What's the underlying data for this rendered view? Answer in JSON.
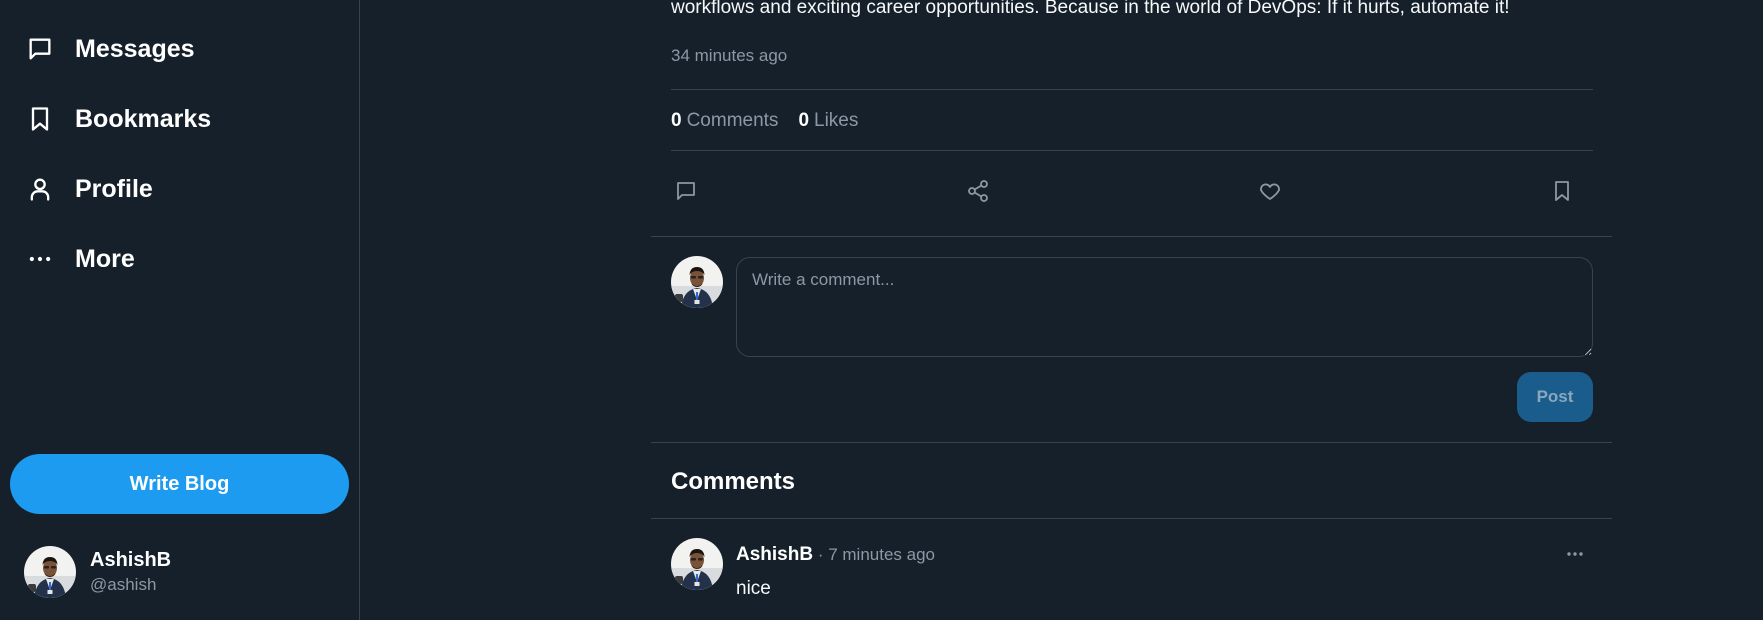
{
  "sidebar": {
    "nav": [
      {
        "label": "Messages",
        "icon": "message-icon"
      },
      {
        "label": "Bookmarks",
        "icon": "bookmark-icon"
      },
      {
        "label": "Profile",
        "icon": "user-icon"
      },
      {
        "label": "More",
        "icon": "more-icon"
      }
    ],
    "write_button": "Write Blog",
    "user": {
      "display_name": "AshishB",
      "handle": "@ashish"
    }
  },
  "post": {
    "text": "workflows and exciting career opportunities. Because in the world of DevOps: If it hurts, automate it!",
    "time": "34 minutes ago",
    "stats": {
      "comments_count": "0",
      "comments_label": "Comments",
      "likes_count": "0",
      "likes_label": "Likes"
    },
    "actions": [
      "comment-icon",
      "share-icon",
      "heart-icon",
      "bookmark-icon"
    ]
  },
  "compose": {
    "placeholder": "Write a comment...",
    "value": "",
    "post_button": "Post"
  },
  "comments": {
    "heading": "Comments",
    "items": [
      {
        "author": "AshishB",
        "separator": "·",
        "time": "7 minutes ago",
        "body": "nice"
      }
    ]
  },
  "colors": {
    "background": "#15202b",
    "accent": "#1d9bf0",
    "border": "#38444d",
    "muted_text": "#8b98a5"
  }
}
